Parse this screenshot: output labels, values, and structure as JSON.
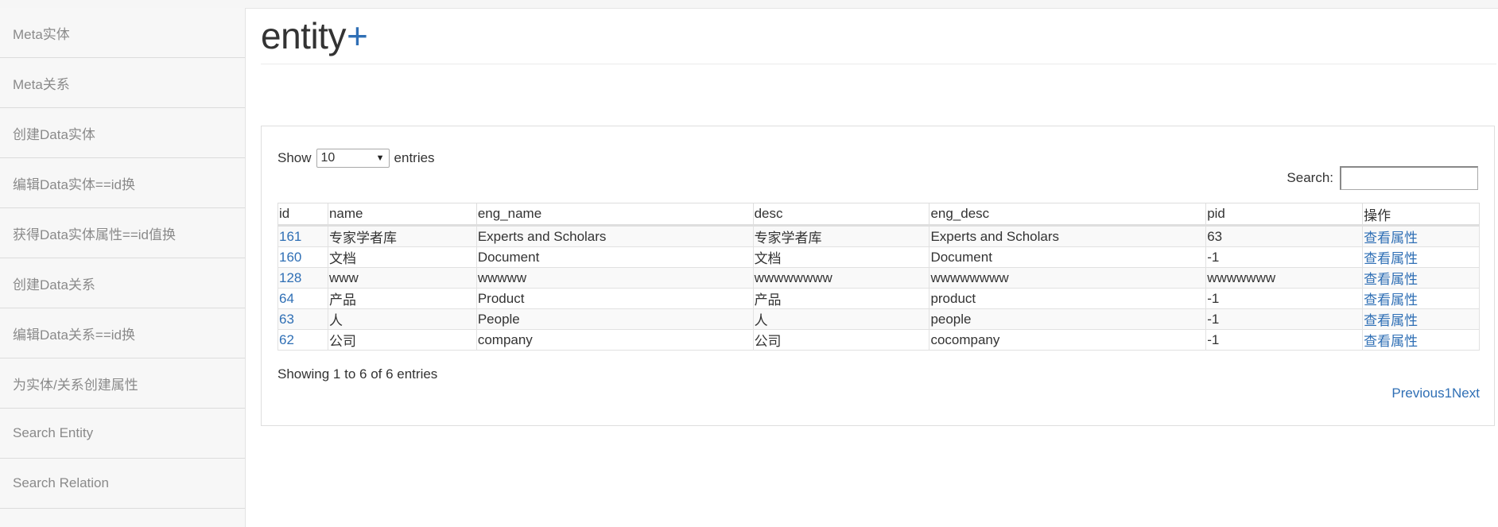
{
  "sidebar": {
    "items": [
      {
        "label": "Meta实体"
      },
      {
        "label": "Meta关系"
      },
      {
        "label": "创建Data实体"
      },
      {
        "label": "编辑Data实体==id换"
      },
      {
        "label": "获得Data实体属性==id值换"
      },
      {
        "label": "创建Data关系"
      },
      {
        "label": "编辑Data关系==id换"
      },
      {
        "label": "为实体/关系创建属性"
      },
      {
        "label": "Search Entity"
      },
      {
        "label": "Search Relation"
      }
    ]
  },
  "header": {
    "title": "entity",
    "plus": "+"
  },
  "controls": {
    "show_label": "Show",
    "page_size": "10",
    "entries_label": "entries",
    "search_label": "Search:",
    "search_value": ""
  },
  "table": {
    "columns": [
      "id",
      "name",
      "eng_name",
      "desc",
      "eng_desc",
      "pid",
      "操作"
    ],
    "rows": [
      {
        "id": "161",
        "name": "专家学者库",
        "eng_name": "Experts and Scholars",
        "desc": "专家学者库",
        "eng_desc": "Experts and Scholars",
        "pid": "63",
        "action": "查看属性"
      },
      {
        "id": "160",
        "name": "文档",
        "eng_name": "Document",
        "desc": "文档",
        "eng_desc": "Document",
        "pid": "-1",
        "action": "查看属性"
      },
      {
        "id": "128",
        "name": "www",
        "eng_name": "wwwww",
        "desc": "wwwwwwww",
        "eng_desc": "wwwwwwww",
        "pid": "wwwwwww",
        "action": "查看属性"
      },
      {
        "id": "64",
        "name": "产品",
        "eng_name": "Product",
        "desc": "产品",
        "eng_desc": "product",
        "pid": "-1",
        "action": "查看属性"
      },
      {
        "id": "63",
        "name": "人",
        "eng_name": "People",
        "desc": "人",
        "eng_desc": "people",
        "pid": "-1",
        "action": "查看属性"
      },
      {
        "id": "62",
        "name": "公司",
        "eng_name": "company",
        "desc": "公司",
        "eng_desc": "cocompany",
        "pid": "-1",
        "action": "查看属性"
      }
    ]
  },
  "footer": {
    "info": "Showing 1 to 6 of 6 entries",
    "previous": "Previous",
    "page": "1",
    "next": "Next"
  },
  "colors": {
    "accent": "#2f6fb5",
    "sidebar_bg": "#f7f7f7",
    "sidebar_text": "#8a8a8a"
  }
}
